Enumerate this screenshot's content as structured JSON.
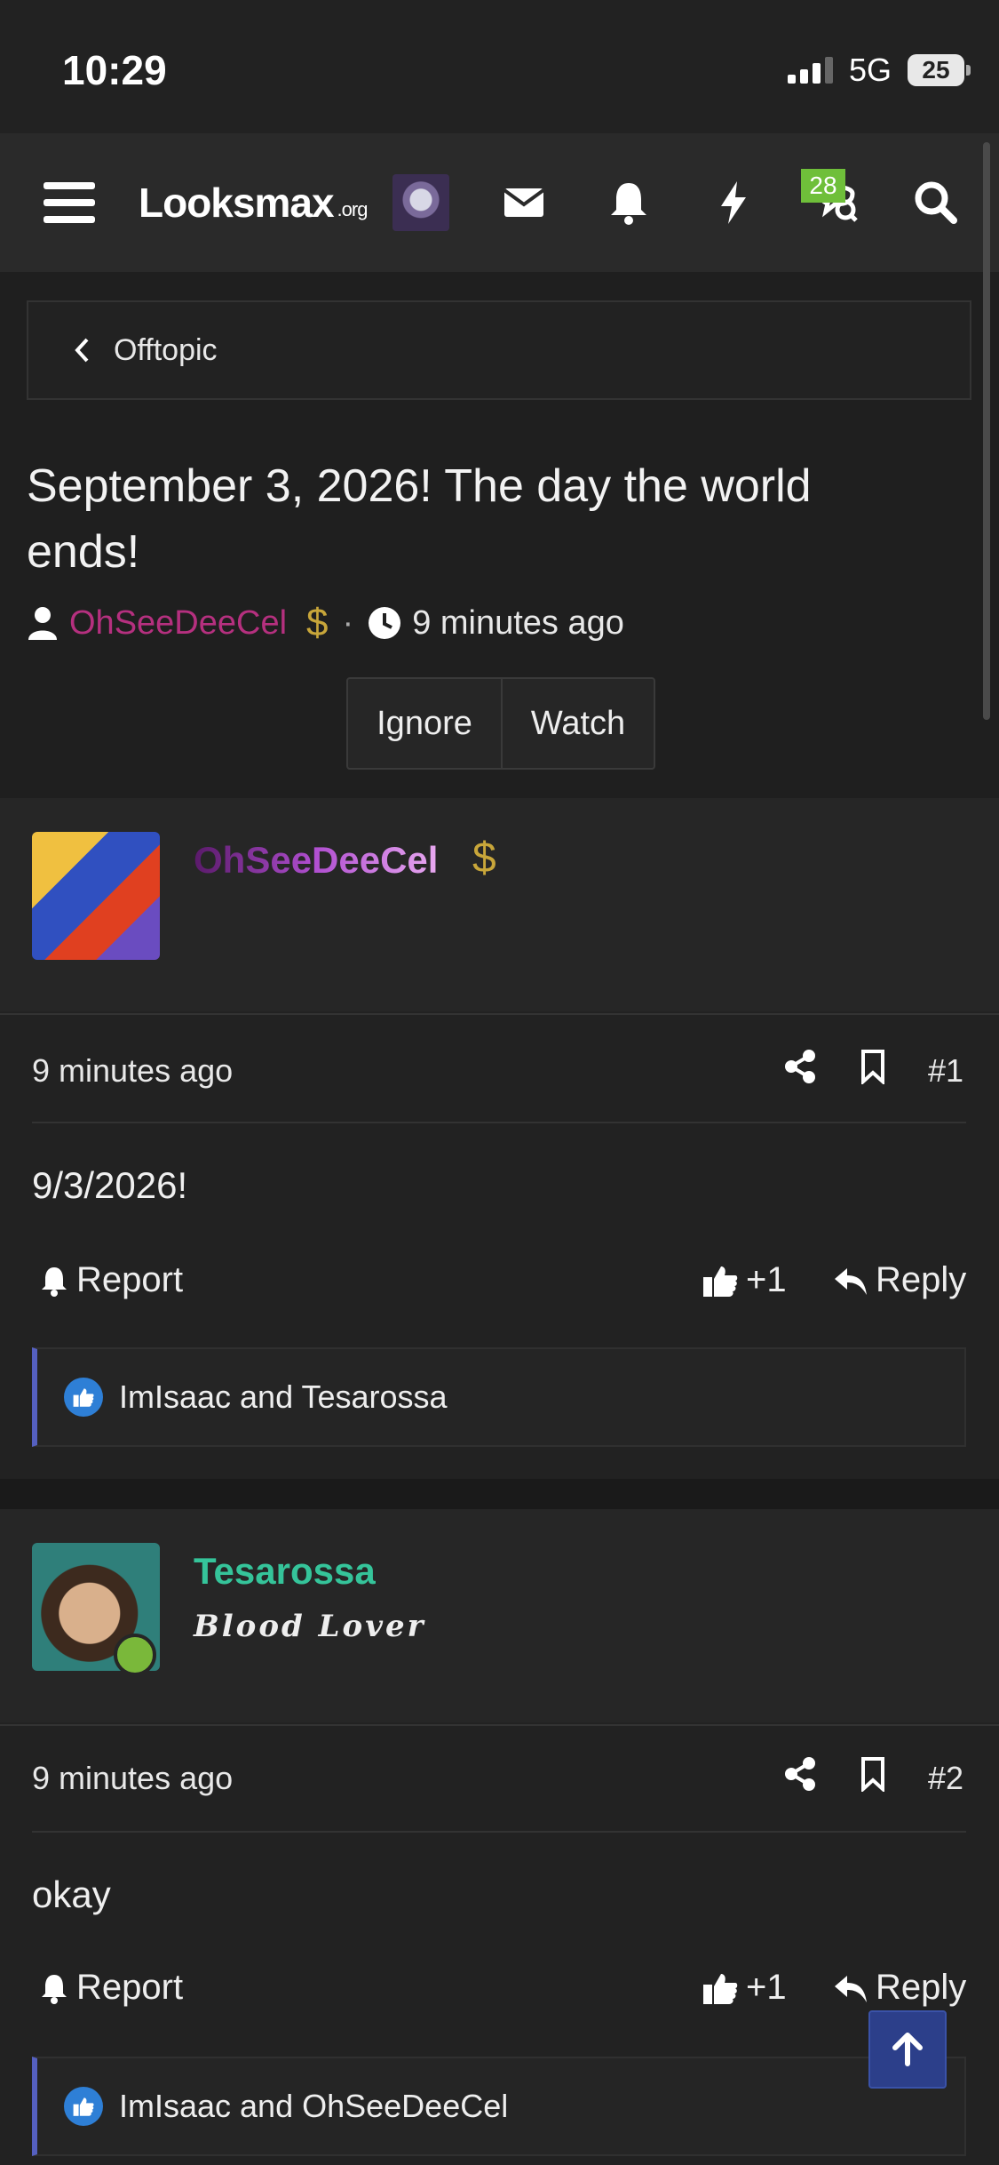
{
  "status_bar": {
    "time": "10:29",
    "network": "5G",
    "battery": "25"
  },
  "nav": {
    "logo": "Looksmax",
    "logo_suffix": ".org",
    "badge_count": "28"
  },
  "breadcrumb": {
    "label": "Offtopic"
  },
  "thread": {
    "title": "September 3, 2026! The day the world ends!",
    "author": "OhSeeDeeCel",
    "author_icon": "$",
    "time": "9 minutes ago",
    "ignore_label": "Ignore",
    "watch_label": "Watch"
  },
  "posts": [
    {
      "username": "OhSeeDeeCel",
      "user_icon": "$",
      "user_title": "",
      "time": "9 minutes ago",
      "number": "#1",
      "content": "9/3/2026!",
      "report_label": "Report",
      "like_label": "+1",
      "reply_label": "Reply",
      "reactions": "ImIsaac and Tesarossa"
    },
    {
      "username": "Tesarossa",
      "user_title": "Blood Lover",
      "time": "9 minutes ago",
      "number": "#2",
      "content": "okay",
      "report_label": "Report",
      "like_label": "+1",
      "reply_label": "Reply",
      "reactions": "ImIsaac and OhSeeDeeCel"
    }
  ],
  "colors": {
    "background": "#1f1f1f",
    "author_link": "#b5307f",
    "gold": "#c8a63a",
    "online": "#7ab83a",
    "badge": "#6fbf3a",
    "accent": "#5560c0"
  }
}
